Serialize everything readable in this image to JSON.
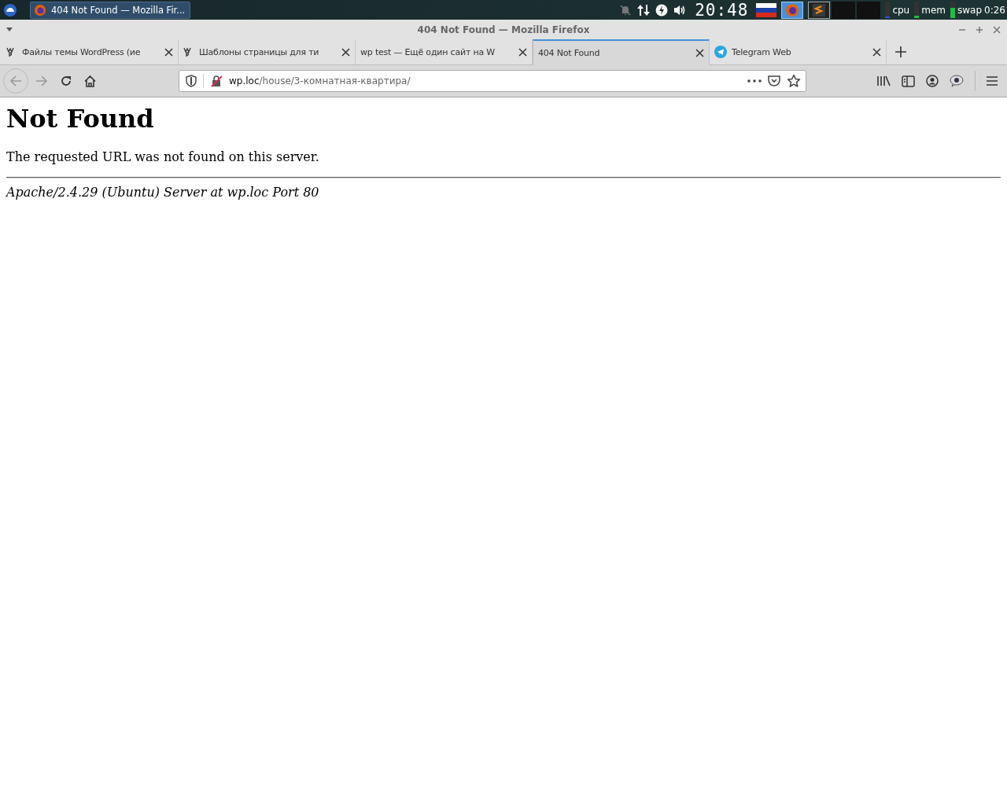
{
  "taskbar": {
    "window_button": {
      "label": "404 Not Found — Mozilla Fir..."
    },
    "clock": "20:48",
    "monitors": [
      {
        "label": "cpu",
        "level": 0.1
      },
      {
        "label": "mem",
        "level": 0.15
      },
      {
        "label": "swap",
        "level": 0.6
      }
    ],
    "uptime": "0:26"
  },
  "window": {
    "title": "404 Not Found — Mozilla Firefox"
  },
  "tabs": [
    {
      "kind": "wp",
      "label": "Файлы темы WordPress (ие",
      "selected": false
    },
    {
      "kind": "wp",
      "label": "Шаблоны страницы для ти",
      "selected": false
    },
    {
      "kind": "none",
      "label": "wp test — Ещё один сайт на W",
      "selected": false
    },
    {
      "kind": "none",
      "label": "404 Not Found",
      "selected": true
    },
    {
      "kind": "telegram",
      "label": "Telegram Web",
      "selected": false
    }
  ],
  "address_bar": {
    "domain": "wp.loc",
    "path": "/house/3-комнатная-квартира/"
  },
  "page": {
    "heading": "Not Found",
    "message": "The requested URL was not found on this server.",
    "signature": "Apache/2.4.29 (Ubuntu) Server at wp.loc Port 80"
  }
}
